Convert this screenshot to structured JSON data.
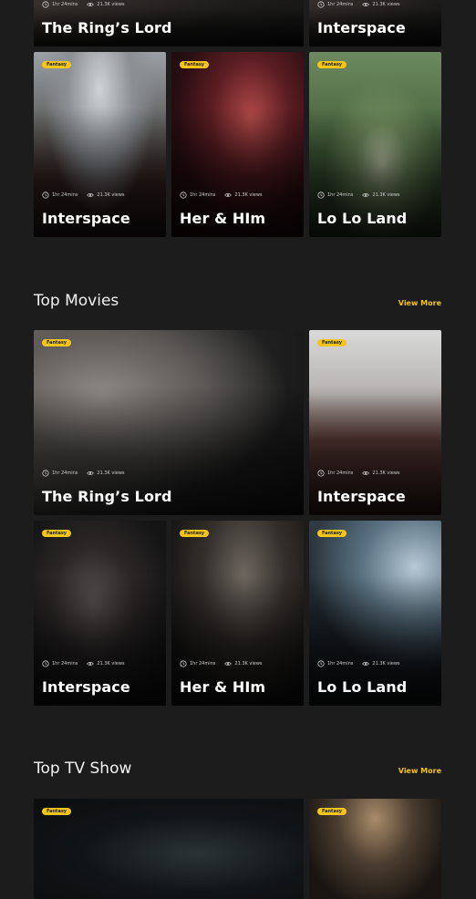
{
  "meta_defaults": {
    "duration": "1hr 24mins",
    "views": "21.3K views"
  },
  "top_section": {
    "cards": [
      {
        "title": "The Ring’s Lord",
        "badge": "",
        "duration": "1hr 24mins",
        "views": "21.3K views"
      },
      {
        "title": "Interspace",
        "badge": "",
        "duration": "1hr 24mins",
        "views": "21.3K views"
      },
      {
        "title": "Interspace",
        "badge": "Fantasy",
        "duration": "1hr 24mins",
        "views": "21.3K views"
      },
      {
        "title": "Her & HIm",
        "badge": "Fantasy",
        "duration": "1hr 24mins",
        "views": "21.3K views"
      },
      {
        "title": "Lo Lo Land",
        "badge": "Fantasy",
        "duration": "1hr 24mins",
        "views": "21.3K views"
      }
    ]
  },
  "top_movies": {
    "heading": "Top Movies",
    "view_more": "View More",
    "cards": [
      {
        "title": "The Ring’s Lord",
        "badge": "Fantasy",
        "duration": "1hr 24mins",
        "views": "21.3K views"
      },
      {
        "title": "Interspace",
        "badge": "Fantasy",
        "duration": "1hr 24mins",
        "views": "21.3K views"
      },
      {
        "title": "Interspace",
        "badge": "Fantasy",
        "duration": "1hr 24mins",
        "views": "21.3K views"
      },
      {
        "title": "Her & HIm",
        "badge": "Fantasy",
        "duration": "1hr 24mins",
        "views": "21.3K views"
      },
      {
        "title": "Lo Lo Land",
        "badge": "Fantasy",
        "duration": "1hr 24mins",
        "views": "21.3K views"
      }
    ]
  },
  "top_tv": {
    "heading": "Top TV Show",
    "view_more": "View More",
    "cards": [
      {
        "badge": "Fantasy"
      },
      {
        "badge": "Fantasy"
      }
    ]
  },
  "colors": {
    "accent": "#f5c518",
    "background": "#1c1c1c"
  }
}
